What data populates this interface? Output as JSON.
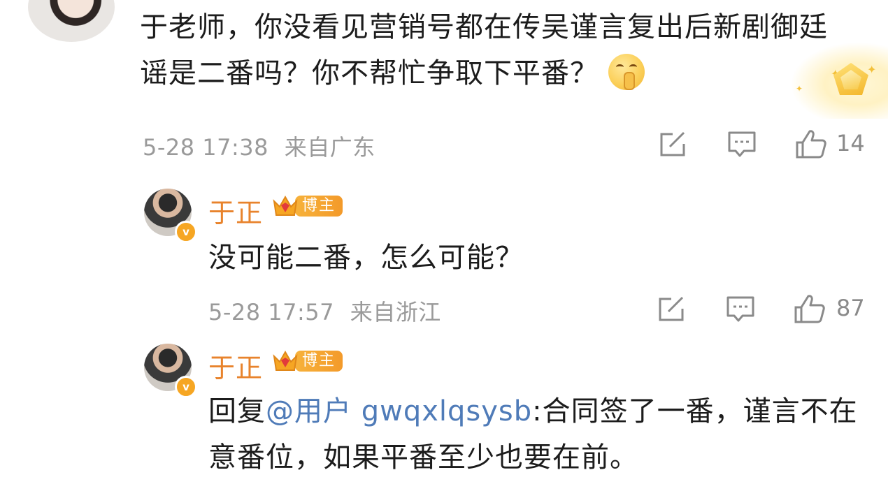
{
  "top_comment": {
    "text": "于老师，你没看见营销号都在传吴谨言复出后新剧御廷谣是二番吗？你不帮忙争取下平番？",
    "emoji": "shushing-face",
    "time": "5-28 17:38",
    "location": "来自广东",
    "like_count": "14"
  },
  "replies": [
    {
      "author": "于正",
      "badge": "博主",
      "text": "没可能二番，怎么可能？",
      "time": "5-28 17:57",
      "location": "来自浙江",
      "like_count": "87"
    },
    {
      "author": "于正",
      "badge": "博主",
      "reply_prefix": "回复",
      "mention": "@用户 gwqxlqsysb",
      "text": ":合同签了一番，谨言不在意番位，如果平番至少也要在前。"
    }
  ],
  "colors": {
    "name": "#e8832c",
    "mention": "#4f7bb8",
    "meta": "#9a9a9a",
    "badge": "#f39a2a"
  }
}
